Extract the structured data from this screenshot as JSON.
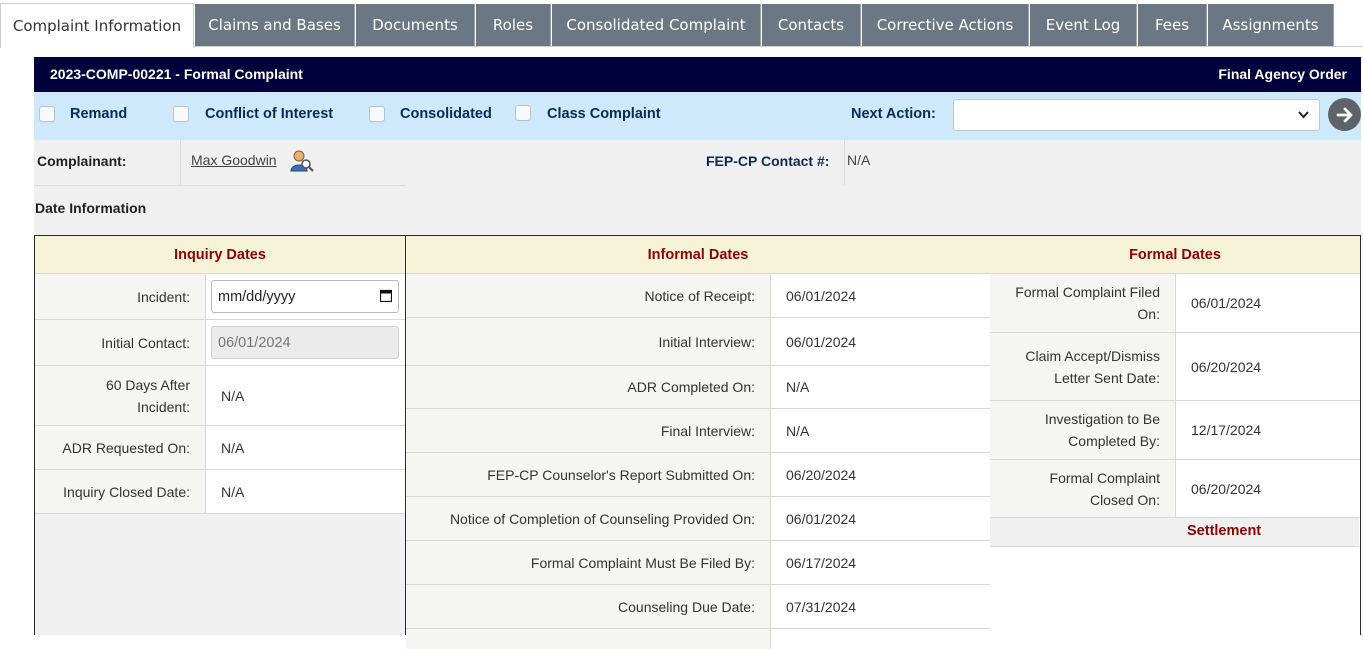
{
  "tabs": [
    {
      "label": "Complaint Information",
      "active": true
    },
    {
      "label": "Claims and Bases"
    },
    {
      "label": "Documents"
    },
    {
      "label": "Roles"
    },
    {
      "label": "Consolidated Complaint"
    },
    {
      "label": "Contacts"
    },
    {
      "label": "Corrective Actions"
    },
    {
      "label": "Event Log"
    },
    {
      "label": "Fees"
    },
    {
      "label": "Assignments"
    }
  ],
  "header": {
    "title": "2023-COMP-00221 - Formal Complaint",
    "status": "Final Agency Order"
  },
  "flags": {
    "remand": "Remand",
    "conflict": "Conflict of Interest",
    "consolidated": "Consolidated",
    "class_complaint": "Class Complaint",
    "next_action_label": "Next Action:",
    "next_action_value": ""
  },
  "complainant": {
    "label": "Complainant:",
    "name": "Max Goodwin",
    "contact_label": "FEP-CP Contact #:",
    "contact_value": "N/A"
  },
  "date_info_title": "Date Information",
  "inquiry": {
    "title": "Inquiry Dates",
    "incident_label": "Incident:",
    "incident_placeholder": "mm/dd/yyyy",
    "initial_contact_label": "Initial Contact:",
    "initial_contact_value": "06/01/2024",
    "days60_label": "60 Days After Incident:",
    "days60_value": "N/A",
    "adr_requested_label": "ADR Requested On:",
    "adr_requested_value": "N/A",
    "closed_label": "Inquiry Closed Date:",
    "closed_value": "N/A"
  },
  "informal": {
    "title": "Informal Dates",
    "rows": [
      {
        "label": "Notice of Receipt:",
        "value": "06/01/2024"
      },
      {
        "label": "Initial Interview:",
        "value": "06/01/2024"
      },
      {
        "label": "ADR Completed On:",
        "value": "N/A"
      },
      {
        "label": "Final Interview:",
        "value": "N/A"
      },
      {
        "label": "FEP-CP Counselor's Report Submitted On:",
        "value": "06/20/2024"
      },
      {
        "label": "Notice of Completion of Counseling Provided On:",
        "value": "06/01/2024"
      },
      {
        "label": "Formal Complaint Must Be Filed By:",
        "value": "06/17/2024"
      },
      {
        "label": "Counseling Due Date:",
        "value": "07/31/2024"
      }
    ]
  },
  "formal": {
    "title": "Formal Dates",
    "rows": [
      {
        "label": "Formal Complaint Filed On:",
        "value": "06/01/2024"
      },
      {
        "label": "Claim Accept/Dismiss Letter Sent Date:",
        "value": "06/20/2024"
      },
      {
        "label": "Investigation to Be Completed By:",
        "value": "12/17/2024"
      },
      {
        "label": "Formal Complaint Closed On:",
        "value": "06/20/2024"
      }
    ],
    "settlement": "Settlement"
  }
}
